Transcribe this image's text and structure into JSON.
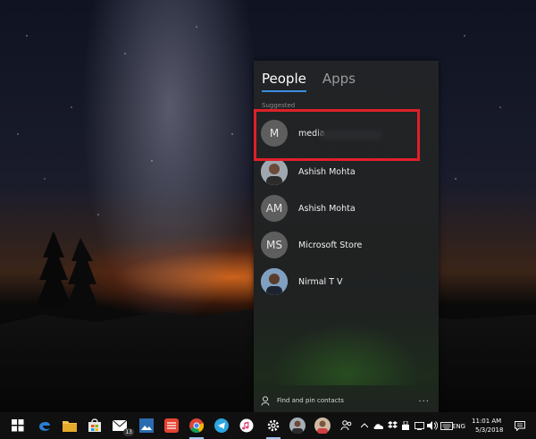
{
  "flyout": {
    "tabs": [
      {
        "label": "People",
        "active": true
      },
      {
        "label": "Apps",
        "active": false
      }
    ],
    "section_label": "Suggested",
    "contacts": [
      {
        "initials": "M",
        "name": "media",
        "photo": false
      },
      {
        "initials": "",
        "name": "Ashish Mohta",
        "photo": true
      },
      {
        "initials": "AM",
        "name": "Ashish Mohta",
        "photo": false
      },
      {
        "initials": "MS",
        "name": "Microsoft Store",
        "photo": false
      },
      {
        "initials": "",
        "name": "Nirmal T V",
        "photo": true
      }
    ],
    "footer_label": "Find and pin contacts",
    "more_label": "···"
  },
  "taskbar": {
    "mail_badge": "13",
    "language": "ENG",
    "time": "11:01 AM",
    "date": "5/3/2018"
  },
  "colors": {
    "accent": "#3b8de0",
    "highlight_box": "#e0202a"
  },
  "icons": {
    "taskbar": [
      "start-icon",
      "edge-icon",
      "file-explorer-icon",
      "store-icon",
      "mail-icon",
      "photos-icon",
      "todoist-icon",
      "chrome-icon",
      "telegram-icon",
      "itunes-icon",
      "settings-icon",
      "people-contact-1-icon",
      "people-contact-2-icon",
      "people-icon"
    ],
    "tray": [
      "chevron-up-icon",
      "onedrive-icon",
      "dropbox-icon",
      "usb-icon",
      "action-icon",
      "volume-icon",
      "keyboard-icon",
      "notifications-icon"
    ]
  }
}
